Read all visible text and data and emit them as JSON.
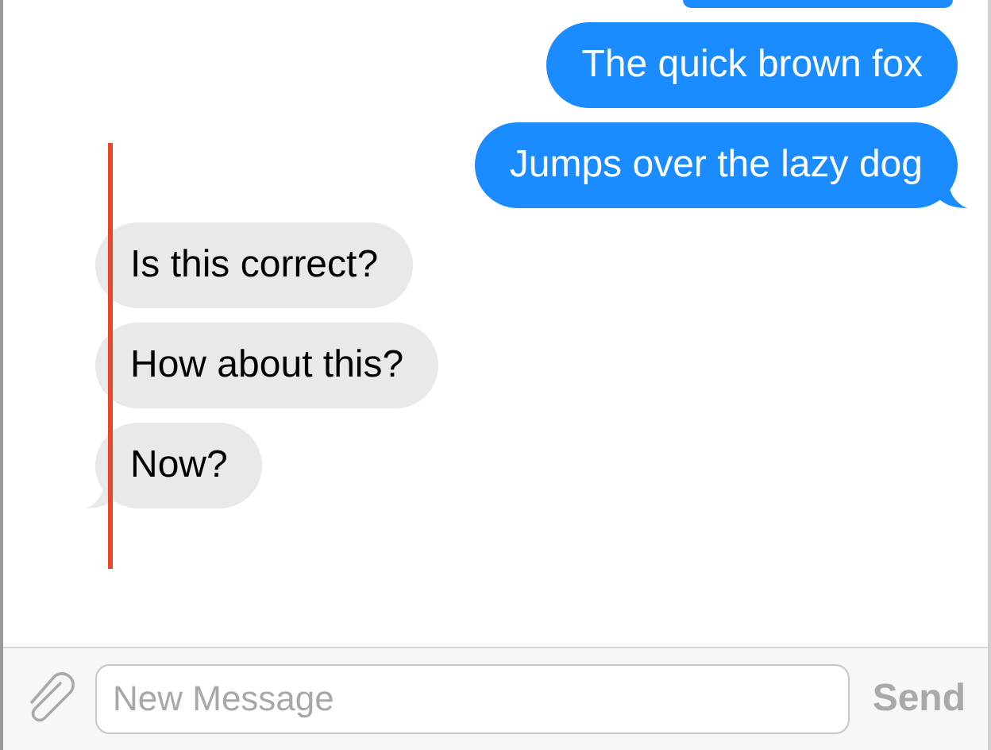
{
  "messages": [
    {
      "text": "The quick brown fox",
      "kind": "sent",
      "tail": false
    },
    {
      "text": "Jumps over the lazy dog",
      "kind": "sent",
      "tail": true
    },
    {
      "text": "Is this correct?",
      "kind": "received",
      "tail": false
    },
    {
      "text": "How about this?",
      "kind": "received",
      "tail": false
    },
    {
      "text": "Now?",
      "kind": "received",
      "tail": true
    }
  ],
  "composer": {
    "placeholder": "New Message",
    "send": {
      "label": "Send",
      "disabled": true
    }
  }
}
